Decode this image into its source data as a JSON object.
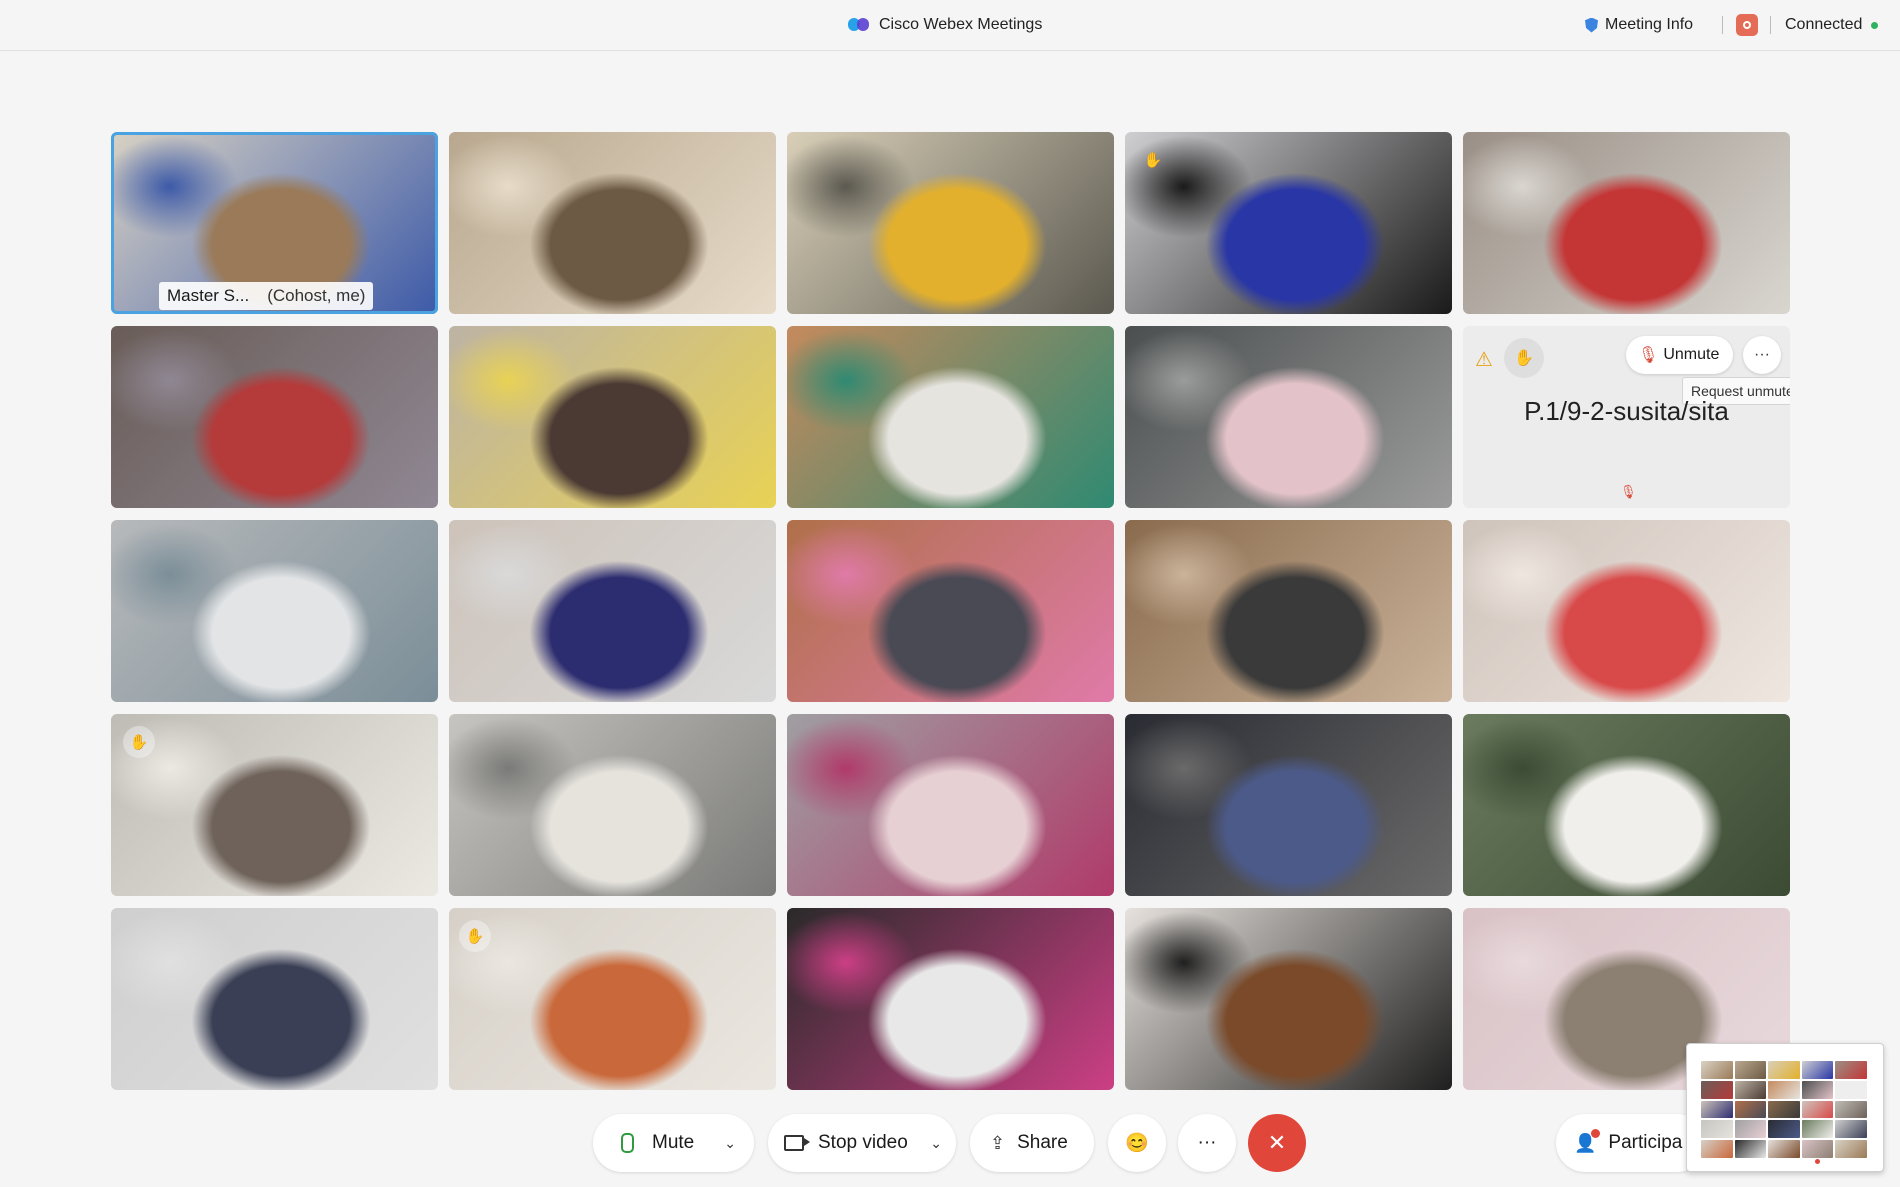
{
  "titlebar": {
    "app_title": "Cisco Webex Meetings",
    "meeting_info": "Meeting Info",
    "connection_status": "Connected",
    "colors": {
      "status": "#2fb160",
      "record": "#e46b55"
    }
  },
  "grid": {
    "active_speaker": {
      "name": "Master S...",
      "role": "(Cohost, me)"
    },
    "placeholder_tile": {
      "participant_name": "P.1/9-2-susita/sita",
      "unmute_label": "Unmute",
      "more_label": "···",
      "tooltip": "Request unmute"
    },
    "tiles": [
      {
        "c1": "#d8d2c4",
        "c2": "#9a7a58",
        "c3": "#3d5aa8"
      },
      {
        "c1": "#b9a88f",
        "c2": "#6d5a45",
        "c3": "#e7dcc9"
      },
      {
        "c1": "#d9cfb8",
        "c2": "#e2b02c",
        "c3": "#5b5950"
      },
      {
        "c1": "#cfcfd2",
        "c2": "#2936a5",
        "c3": "#1a1a1a"
      },
      {
        "c1": "#9a8f86",
        "c2": "#c43535",
        "c3": "#d9d6d0"
      },
      {
        "c1": "#6a5d58",
        "c2": "#b53a3a",
        "c3": "#8f8793"
      },
      {
        "c1": "#bdb3a4",
        "c2": "#4b3a33",
        "c3": "#e8d255"
      },
      {
        "c1": "#c48a5d",
        "c2": "#e6e4df",
        "c3": "#2f8a72"
      },
      {
        "c1": "#4b4f4f",
        "c2": "#e3c3c9",
        "c3": "#9b9b9b"
      },
      {
        "c1": "#b7b9bb",
        "c2": "#e2e4e6",
        "c3": "#7b8e98"
      },
      {
        "c1": "#cdc3ba",
        "c2": "#2c2c70",
        "c3": "#d9d9d9"
      },
      {
        "c1": "#b0704a",
        "c2": "#4a4a55",
        "c3": "#e07aa8"
      },
      {
        "c1": "#8a6b4e",
        "c2": "#3a3a3a",
        "c3": "#cab39a"
      },
      {
        "c1": "#cfc4bc",
        "c2": "#d84a4a",
        "c3": "#efe6e0"
      },
      {
        "c1": "#bfbcb6",
        "c2": "#6e625a",
        "c3": "#ece9e3"
      },
      {
        "c1": "#c6c5c0",
        "c2": "#e6e3dd",
        "c3": "#7a7a78"
      },
      {
        "c1": "#9f9fa2",
        "c2": "#e7d0d4",
        "c3": "#b03a6a"
      },
      {
        "c1": "#2a2c33",
        "c2": "#4c5a8a",
        "c3": "#6b6a6a"
      },
      {
        "c1": "#6a7b5e",
        "c2": "#f0efeb",
        "c3": "#3c4b34"
      },
      {
        "c1": "#cfcfcf",
        "c2": "#3a3f55",
        "c3": "#e0e0e0"
      },
      {
        "c1": "#d6d0c8",
        "c2": "#c9683a",
        "c3": "#ebe7e0"
      },
      {
        "c1": "#2a2a2a",
        "c2": "#e8e8e8",
        "c3": "#cc3f85"
      },
      {
        "c1": "#e6e1dc",
        "c2": "#7a4a2a",
        "c3": "#1f1f1f"
      },
      {
        "c1": "#d9c2c6",
        "c2": "#8c8072",
        "c3": "#e8d9dc"
      }
    ]
  },
  "controls": {
    "mute_label": "Mute",
    "stop_video_label": "Stop video",
    "share_label": "Share",
    "reactions_icon": "😊",
    "more_icon": "···",
    "end_icon": "✕",
    "participants_label": "Participa",
    "colors": {
      "end": "#e0463a",
      "mic": "#2e9b3e"
    }
  }
}
